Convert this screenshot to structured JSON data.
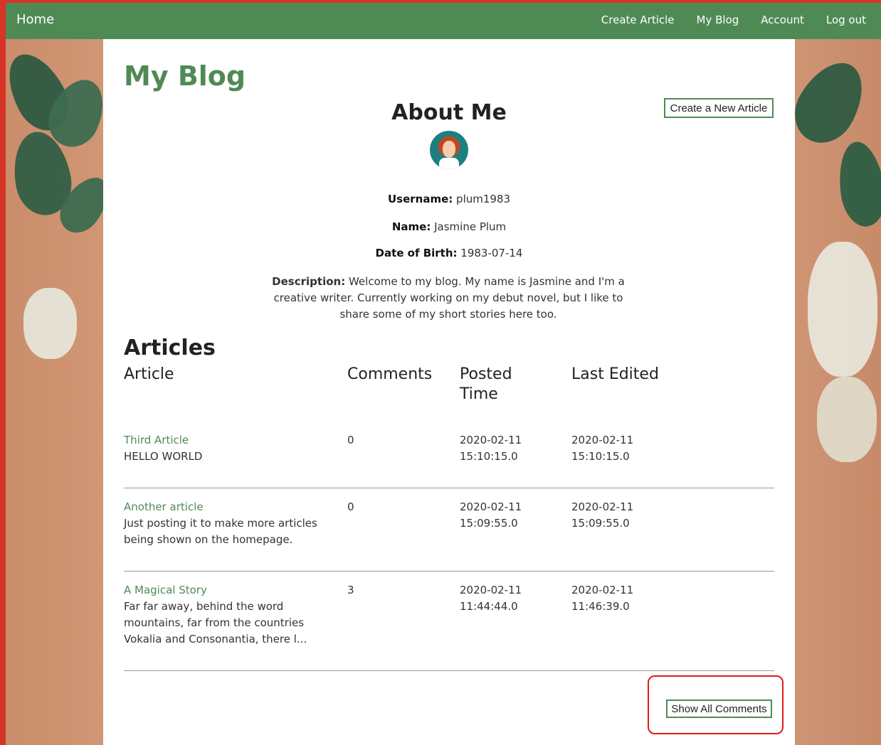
{
  "nav": {
    "home": "Home",
    "items": [
      "Create Article",
      "My Blog",
      "Account",
      "Log out"
    ]
  },
  "page": {
    "title": "My Blog",
    "new_article_button": "Create a New Article",
    "about_title": "About Me",
    "avatar_icon": "female-user-avatar-icon",
    "username_label": "Username:",
    "username": "plum1983",
    "name_label": "Name:",
    "name": "Jasmine Plum",
    "dob_label": "Date of Birth:",
    "dob": "1983-07-14",
    "description_label": "Description:",
    "description": "Welcome to my blog. My name is Jasmine and I'm a creative writer. Currently working on my debut novel, but I like to share some of my short stories here too."
  },
  "articles": {
    "title": "Articles",
    "headers": [
      "Article",
      "Comments",
      "Posted Time",
      "Last Edited"
    ],
    "rows": [
      {
        "title": "Third Article",
        "excerpt": "HELLO WORLD",
        "comments": "0",
        "posted": "2020-02-11 15:10:15.0",
        "edited": "2020-02-11 15:10:15.0"
      },
      {
        "title": "Another article",
        "excerpt": "Just posting it to make more articles being shown on the homepage.",
        "comments": "0",
        "posted": "2020-02-11 15:09:55.0",
        "edited": "2020-02-11 15:09:55.0"
      },
      {
        "title": "A Magical Story",
        "excerpt": "Far far away, behind the word mountains, far from the countries Vokalia and Consonantia, there l...",
        "comments": "3",
        "posted": "2020-02-11 11:44:44.0",
        "edited": "2020-02-11 11:46:39.0"
      }
    ]
  },
  "show_comments_button": "Show All Comments"
}
